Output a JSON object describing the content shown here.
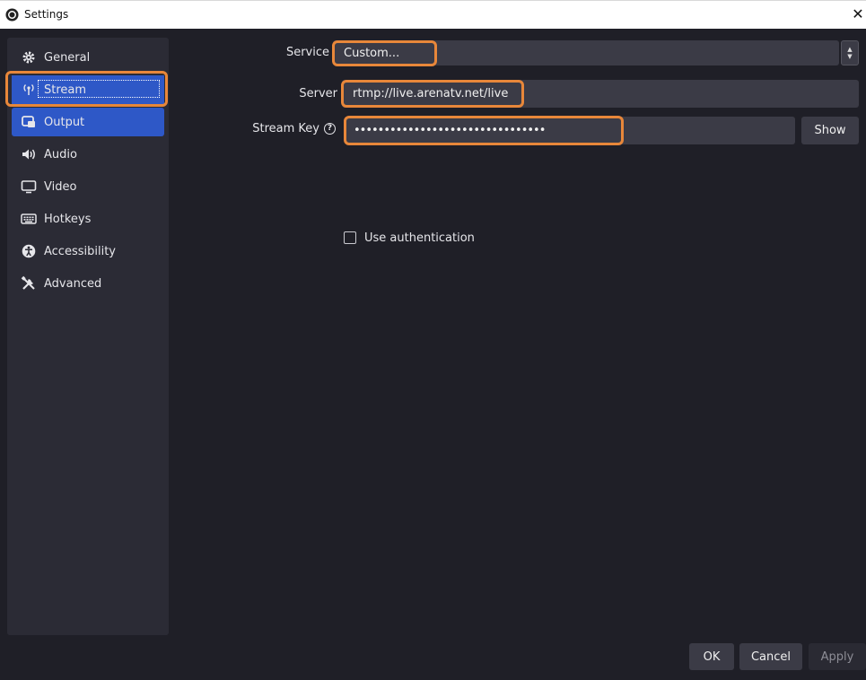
{
  "window": {
    "title": "Settings"
  },
  "sidebar": {
    "items": [
      {
        "label": "General",
        "icon": "gear-icon"
      },
      {
        "label": "Stream",
        "icon": "antenna-icon"
      },
      {
        "label": "Output",
        "icon": "output-icon"
      },
      {
        "label": "Audio",
        "icon": "speaker-icon"
      },
      {
        "label": "Video",
        "icon": "monitor-icon"
      },
      {
        "label": "Hotkeys",
        "icon": "keyboard-icon"
      },
      {
        "label": "Accessibility",
        "icon": "accessibility-icon"
      },
      {
        "label": "Advanced",
        "icon": "tools-icon"
      }
    ]
  },
  "stream": {
    "service_label": "Service",
    "service_value": "Custom...",
    "server_label": "Server",
    "server_value": "rtmp://live.arenatv.net/live",
    "key_label": "Stream Key",
    "key_value": "••••••••••••••••••••••••••••••••",
    "show_label": "Show",
    "auth_label": "Use authentication"
  },
  "footer": {
    "ok": "OK",
    "cancel": "Cancel",
    "apply": "Apply"
  },
  "colors": {
    "accent": "#2e58c7",
    "highlight": "#e8873a",
    "background": "#1f1f27"
  }
}
